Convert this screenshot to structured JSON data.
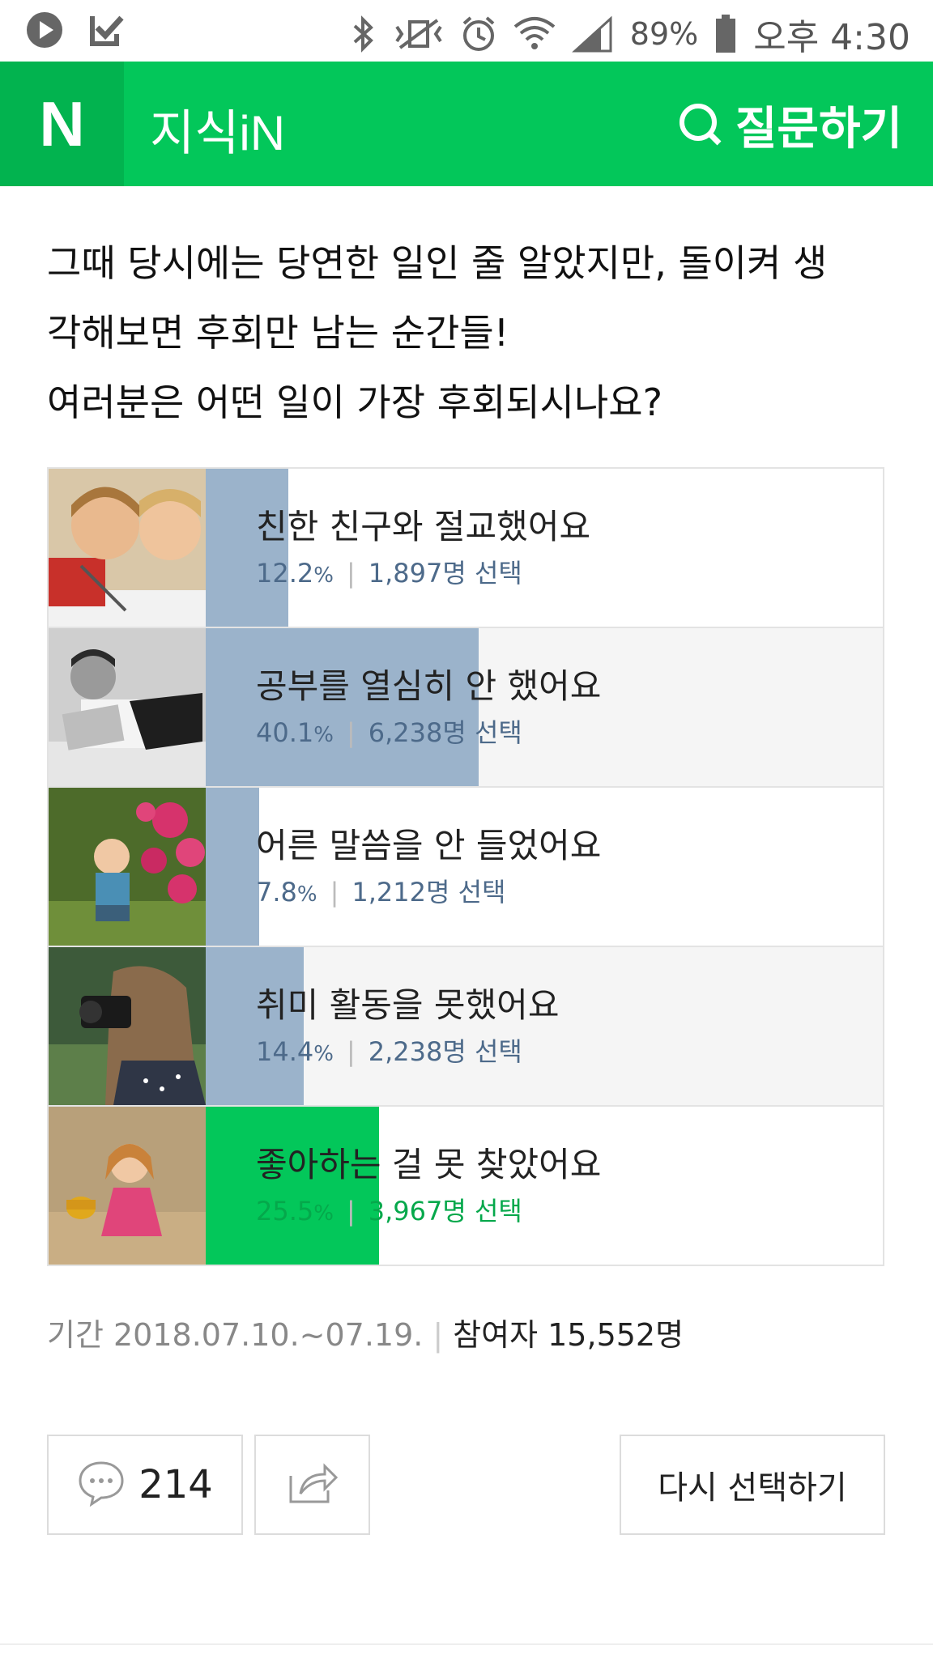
{
  "status_bar": {
    "battery": "89%",
    "time": "오후 4:30",
    "icons": [
      "play-icon",
      "check-app-icon",
      "bluetooth-icon",
      "vibrate-icon",
      "alarm-icon",
      "wifi-icon",
      "signal-icon",
      "battery-icon"
    ]
  },
  "header": {
    "logo": "N",
    "brand": "지식iN",
    "ask_label": "질문하기"
  },
  "question": {
    "lines": [
      "그때 당시에는 당연한 일인 줄 알았지만, 돌이켜 생",
      "각해보면 후회만 남는 순간들!",
      "여러분은 어떤 일이 가장 후회되시나요?"
    ]
  },
  "poll": {
    "options": [
      {
        "label": "친한 친구와 절교했어요",
        "percent_text": "12.2",
        "pct_sym": "%",
        "count": "1,897명 선택",
        "percent": 12.2,
        "selected": false
      },
      {
        "label": "공부를 열심히 안 했어요",
        "percent_text": "40.1",
        "pct_sym": "%",
        "count": "6,238명 선택",
        "percent": 40.1,
        "selected": false
      },
      {
        "label": "어른 말씀을 안 들었어요",
        "percent_text": "7.8",
        "pct_sym": "%",
        "count": "1,212명 선택",
        "percent": 7.8,
        "selected": false
      },
      {
        "label": "취미 활동을 못했어요",
        "percent_text": "14.4",
        "pct_sym": "%",
        "count": "2,238명 선택",
        "percent": 14.4,
        "selected": false
      },
      {
        "label": "좋아하는 걸 못 찾았어요",
        "percent_text": "25.5",
        "pct_sym": "%",
        "count": "3,967명 선택",
        "percent": 25.5,
        "selected": true
      }
    ],
    "colors": {
      "bar": "#9bb3cb",
      "selected_bar": "#03c75a"
    }
  },
  "meta": {
    "period": "기간 2018.07.10.~07.19.",
    "participants": "참여자 15,552명"
  },
  "actions": {
    "comment_count": "214",
    "reselect_label": "다시 선택하기"
  },
  "colors": {
    "brand_green": "#03c75a"
  }
}
